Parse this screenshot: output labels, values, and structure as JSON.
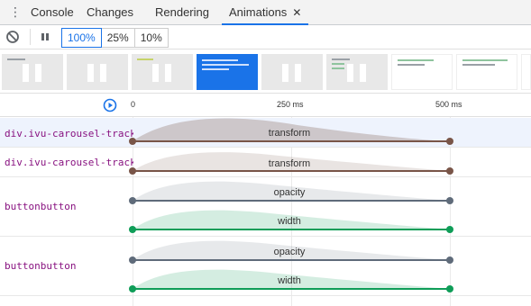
{
  "tabs": [
    {
      "label": "Console",
      "active": false
    },
    {
      "label": "Changes",
      "active": false
    },
    {
      "label": "Rendering",
      "active": false
    },
    {
      "label": "Animations",
      "active": true
    }
  ],
  "tab_close_glyph": "✕",
  "more_tabs_glyph": "⋮",
  "toolbar": {
    "clear_icon": "clear-all-icon",
    "pause_icon": "pause-icon",
    "speeds": [
      {
        "label": "100%",
        "selected": true
      },
      {
        "label": "25%",
        "selected": false
      },
      {
        "label": "10%",
        "selected": false
      }
    ]
  },
  "timeline": {
    "replay_icon": "replay-icon",
    "ticks": [
      "0",
      "250 ms",
      "500 ms"
    ]
  },
  "rows": [
    {
      "node": "div.ivu-carousel-track",
      "selected": true,
      "tracks": [
        {
          "property": "transform",
          "color": "#795548"
        }
      ]
    },
    {
      "node": "div.ivu-carousel-track",
      "selected": false,
      "tracks": [
        {
          "property": "transform",
          "color": "#795548"
        }
      ]
    },
    {
      "node": "buttonbutton",
      "selected": false,
      "tracks": [
        {
          "property": "opacity",
          "color": "#5f6b7a"
        },
        {
          "property": "width",
          "color": "#0f9d58"
        }
      ]
    },
    {
      "node": "buttonbutton",
      "selected": false,
      "tracks": [
        {
          "property": "opacity",
          "color": "#5f6b7a"
        },
        {
          "property": "width",
          "color": "#0f9d58"
        }
      ]
    }
  ]
}
